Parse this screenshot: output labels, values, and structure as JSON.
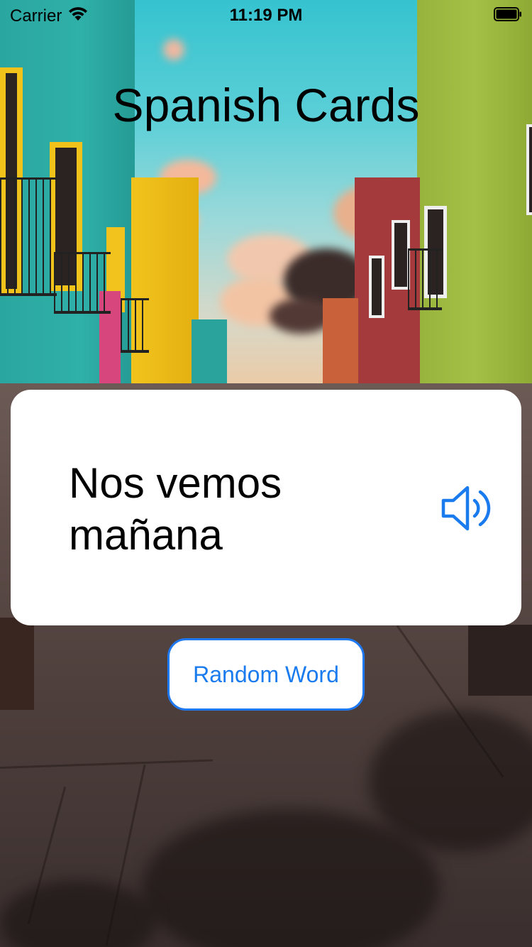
{
  "status_bar": {
    "carrier": "Carrier",
    "time": "11:19 PM"
  },
  "app": {
    "title": "Spanish Cards"
  },
  "card": {
    "phrase": "Nos vemos mañana",
    "speaker_icon": "speaker-icon"
  },
  "actions": {
    "random_word_label": "Random Word"
  },
  "colors": {
    "accent": "#1a7bee",
    "card_background": "#ffffff",
    "sky": "#35c3cf"
  }
}
